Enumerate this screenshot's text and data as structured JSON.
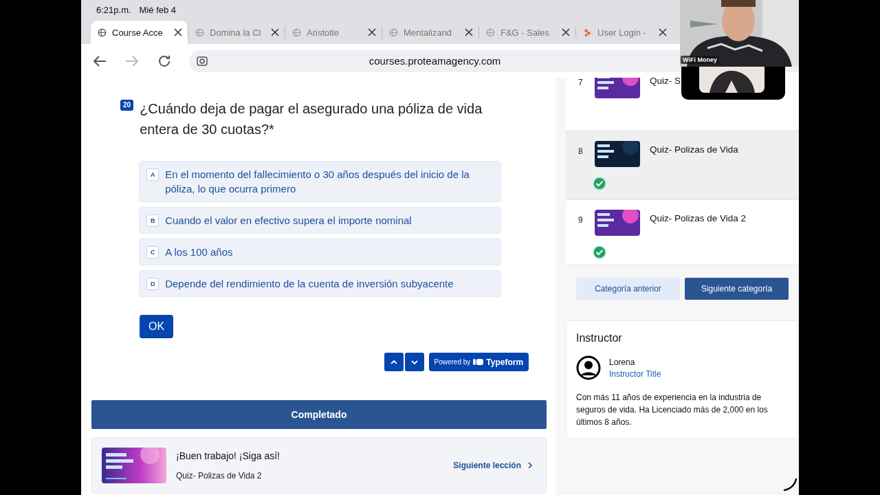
{
  "status_bar": {
    "time": "6:21p.m.",
    "date": "Mié feb 4"
  },
  "tabs": [
    {
      "title": "Course Acce",
      "selected": true,
      "kind": "site"
    },
    {
      "title": "Domina la Cl",
      "selected": false,
      "kind": "site"
    },
    {
      "title": "Aristotle",
      "selected": false,
      "kind": "site"
    },
    {
      "title": "Mentalizand",
      "selected": false,
      "kind": "site"
    },
    {
      "title": "F&G - Sales",
      "selected": false,
      "kind": "site"
    },
    {
      "title": "User Login -",
      "selected": false,
      "kind": "app"
    }
  ],
  "address_bar": {
    "url": "courses.proteamagency.com"
  },
  "question": {
    "number": "20",
    "text": "¿Cuándo deja de pagar el asegurado una póliza de vida entera de 30 cuotas?*",
    "options": [
      {
        "key": "A",
        "text": "En el momento del fallecimiento o 30 años después del inicio de la póliza, lo que ocurra primero"
      },
      {
        "key": "B",
        "text": "Cuando el valor en efectivo supera el importe nominal"
      },
      {
        "key": "C",
        "text": "A los 100 años"
      },
      {
        "key": "D",
        "text": "Depende del rendimiento de la cuenta de inversión subyacente"
      }
    ],
    "ok_button": "OK",
    "powered_by": "Powered by",
    "brand": "Typeform"
  },
  "completed_button": "Completado",
  "next_lesson": {
    "message": "¡Buen trabajo! ¡Siga así!",
    "title": "Quiz- Polizas de Vida 2",
    "link": "Siguiente lección"
  },
  "lessons": [
    {
      "number": "7",
      "title": "Quiz- S",
      "completed": false,
      "selected": false
    },
    {
      "number": "8",
      "title": "Quiz- Polizas de Vida",
      "completed": true,
      "selected": true
    },
    {
      "number": "9",
      "title": "Quiz- Polizas de Vida 2",
      "completed": true,
      "selected": false
    }
  ],
  "category_buttons": {
    "previous": "Categoría anterior",
    "next": "Siguiente categoría"
  },
  "instructor": {
    "heading": "Instructor",
    "name": "Lorena",
    "title": "Instructor Title",
    "bio": "Con más 11 años de experiencia en la industria de seguros de vida. Ha Licenciado más de 2,000 en los últimos 8 años."
  },
  "video_call": {
    "name": "WiFi Money"
  }
}
